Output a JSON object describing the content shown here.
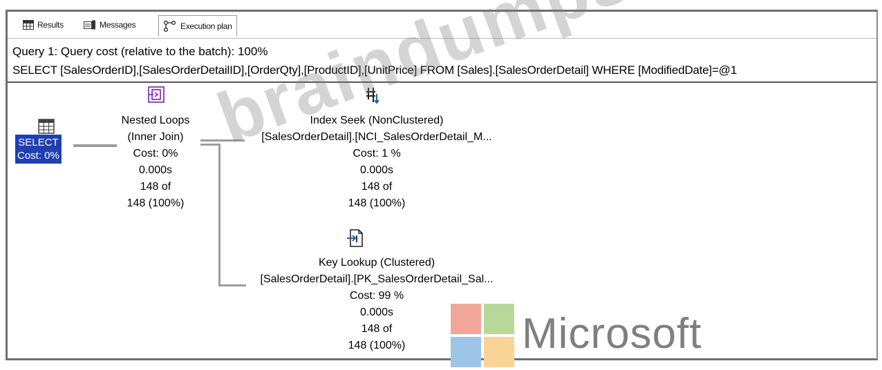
{
  "tabs": [
    {
      "label": "Results",
      "icon": "grid-icon"
    },
    {
      "label": "Messages",
      "icon": "messages-icon"
    },
    {
      "label": "Execution plan",
      "icon": "execution-plan-icon"
    }
  ],
  "query": {
    "header": "Query 1: Query cost (relative to the batch): 100%",
    "sql": "SELECT [SalesOrderID],[SalesOrderDetailID],[OrderQty],[ProductID],[UnitPrice] FROM [Sales].[SalesOrderDetail] WHERE [ModifiedDate]=@1"
  },
  "nodes": {
    "select": {
      "name": "SELECT",
      "cost": "Cost: 0%",
      "icon": "select-result-icon"
    },
    "nested_loops": {
      "name": "Nested Loops",
      "join": "(Inner Join)",
      "cost": "Cost: 0%",
      "time": "0.000s",
      "rows": "148 of",
      "total": "148 (100%)",
      "icon": "nested-loops-icon"
    },
    "index_seek": {
      "name": "Index Seek (NonClustered)",
      "object": "[SalesOrderDetail].[NCI_SalesOrderDetail_M...",
      "cost": "Cost: 1 %",
      "time": "0.000s",
      "rows": "148 of",
      "total": "148 (100%)",
      "icon": "index-seek-icon"
    },
    "key_lookup": {
      "name": "Key Lookup (Clustered)",
      "object": "[SalesOrderDetail].[PK_SalesOrderDetail_Sal...",
      "cost": "Cost: 99 %",
      "time": "0.000s",
      "rows": "148 of",
      "total": "148 (100%)",
      "icon": "key-lookup-icon"
    }
  },
  "watermark": "braindumpsqa.com",
  "logo": {
    "text": "Microsoft",
    "colors": [
      "#f1a69a",
      "#b8d89a",
      "#9cc5e8",
      "#fad396"
    ]
  },
  "colors": {
    "selection": "#1f3fb3",
    "connector": "#9c9c9c",
    "icon_purple": "#7a1fa6"
  }
}
